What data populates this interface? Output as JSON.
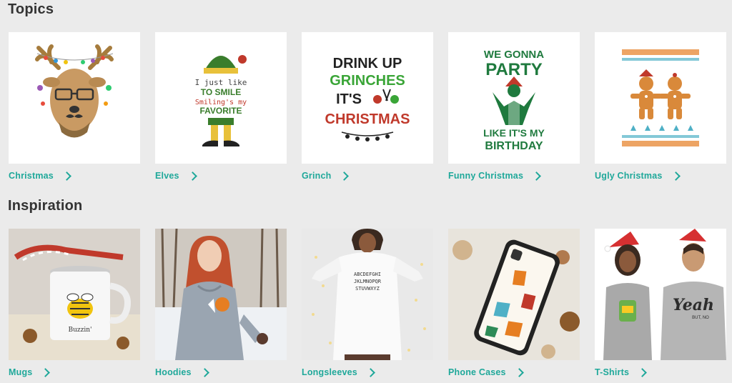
{
  "sections": {
    "topics": {
      "title": "Topics",
      "items": [
        {
          "label": "Christmas",
          "image": "reindeer-with-glasses-design"
        },
        {
          "label": "Elves",
          "image": "elf-legs-design",
          "art_text": [
            "I just like",
            "TO SMILE",
            "Smiling's my",
            "FAVORITE"
          ]
        },
        {
          "label": "Grinch",
          "image": "drink-up-grinches-design",
          "art_text": [
            "DRINK UP",
            "GRINCHES",
            "IT'S",
            "CHRISTMAS"
          ]
        },
        {
          "label": "Funny Christmas",
          "image": "party-birthday-design",
          "art_text": [
            "WE GONNA",
            "PARTY",
            "LIKE IT'S MY",
            "BIRTHDAY"
          ]
        },
        {
          "label": "Ugly Christmas",
          "image": "gingerbread-sweater-design"
        }
      ]
    },
    "inspiration": {
      "title": "Inspiration",
      "items": [
        {
          "label": "Mugs",
          "image": "mug-photo",
          "art_text": [
            "Buzzin'"
          ]
        },
        {
          "label": "Hoodies",
          "image": "hoodie-photo"
        },
        {
          "label": "Longsleeves",
          "image": "longsleeve-photo",
          "art_text": [
            "ABCDEFGHI",
            "JKLMNOPQR",
            "STUVWXYZ"
          ]
        },
        {
          "label": "Phone Cases",
          "image": "phone-case-photo"
        },
        {
          "label": "T-Shirts",
          "image": "tshirts-photo",
          "art_text": [
            "Yeah",
            "BUT, NO"
          ]
        }
      ]
    }
  },
  "colors": {
    "accent": "#1fa89a",
    "background": "#ebebeb",
    "heading": "#333333"
  },
  "icons": {
    "link_arrow": "chevron-right-icon"
  }
}
